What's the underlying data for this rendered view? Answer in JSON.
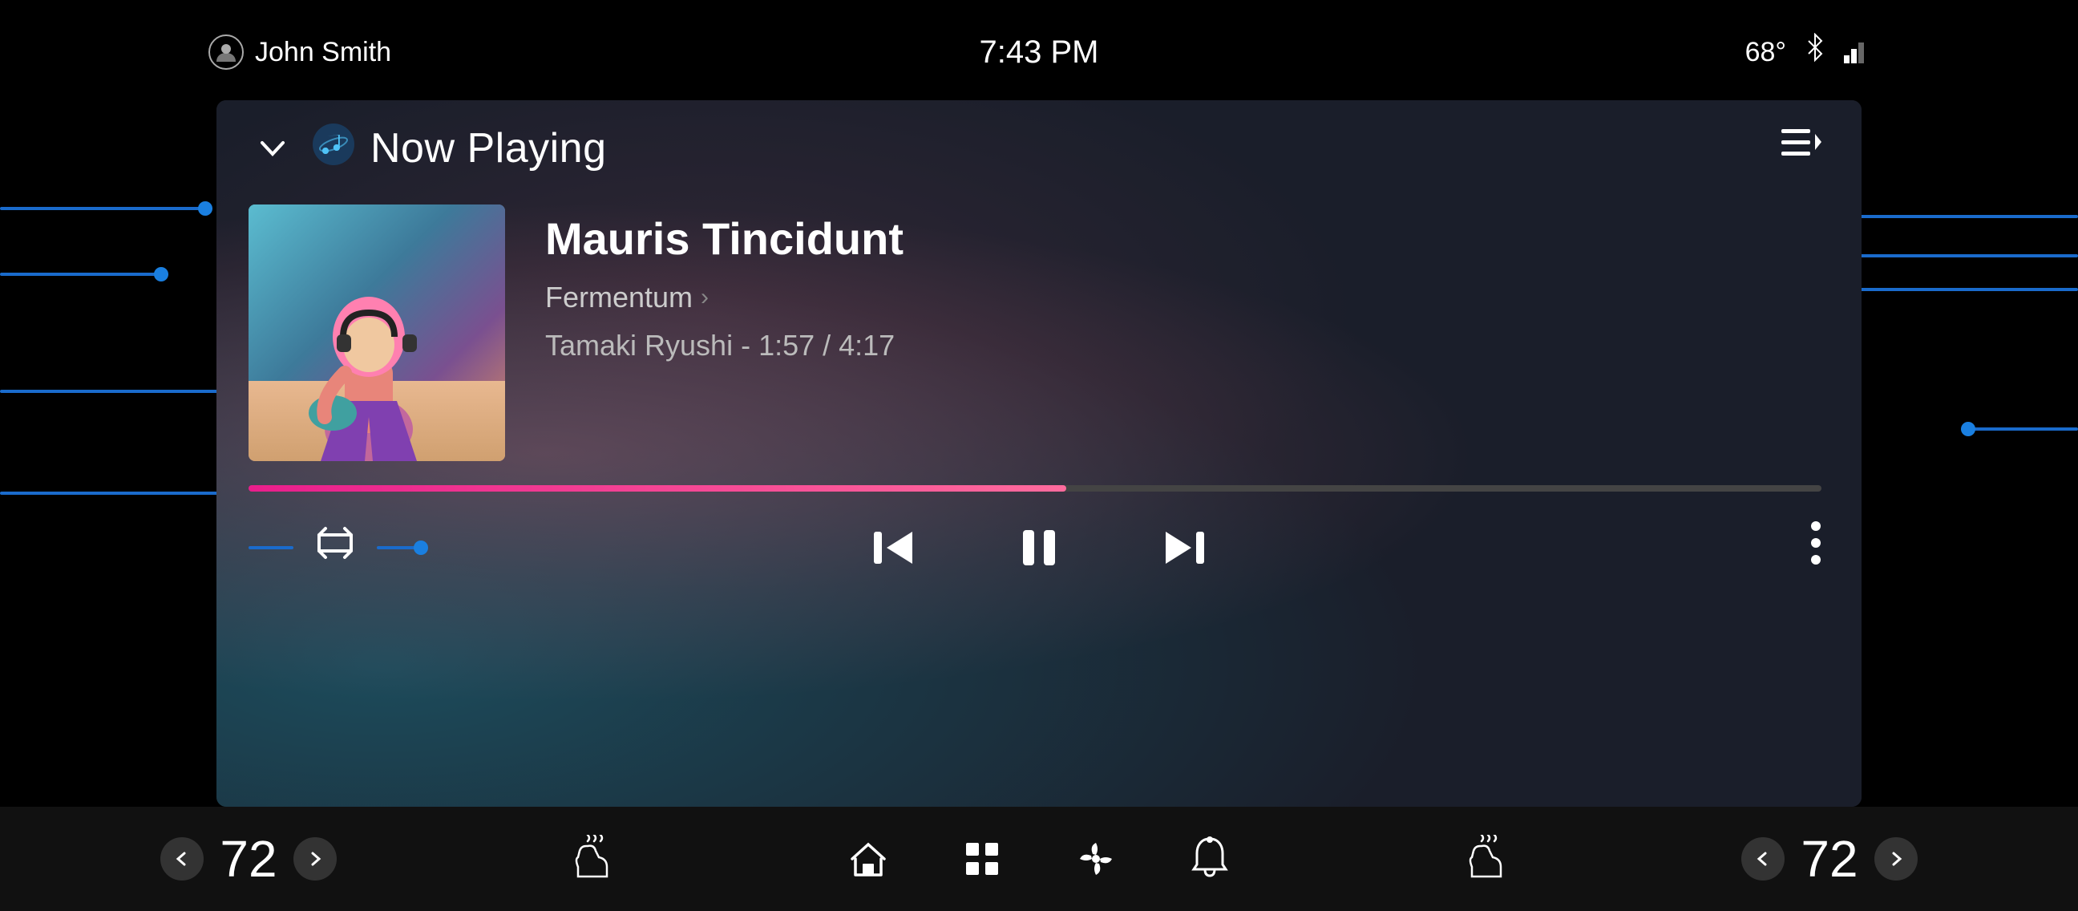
{
  "statusBar": {
    "user": "John Smith",
    "time": "7:43 PM",
    "temperature": "68°"
  },
  "header": {
    "nowPlayingLabel": "Now Playing"
  },
  "track": {
    "title": "Mauris Tincidunt",
    "album": "Fermentum",
    "artistTime": "Tamaki Ryushi - 1:57 / 4:17",
    "progressPercent": 52
  },
  "controls": {
    "repeatLabel": "⇄",
    "prevLabel": "⏮",
    "pauseLabel": "⏸",
    "nextLabel": "⏭",
    "moreLabel": "⋮"
  },
  "bottomBar": {
    "leftTemp": "72",
    "rightTemp": "72",
    "leftTempArrowLeft": "‹",
    "leftTempArrowRight": "›",
    "rightTempArrowLeft": "‹",
    "rightTempArrowRight": "›"
  }
}
